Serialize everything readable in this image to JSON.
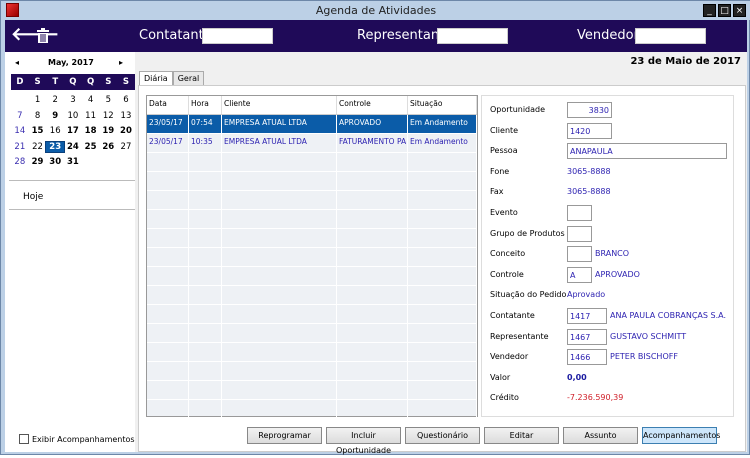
{
  "window": {
    "title": "Agenda de Atividades",
    "controls": [
      "_",
      "□",
      "×"
    ]
  },
  "header": {
    "contatante_label": "Contatante",
    "representante_label": "Representante",
    "vendedor_label": "Vendedor",
    "contatante_value": "",
    "representante_value": "",
    "vendedor_value": ""
  },
  "calendar": {
    "month": "May, 2017",
    "prev": "◂",
    "next": "▸",
    "weekdays": [
      "D",
      "S",
      "T",
      "Q",
      "Q",
      "S",
      "S"
    ],
    "weeks": [
      [
        "",
        "1",
        "2",
        "3",
        "4",
        "5",
        "6"
      ],
      [
        "7",
        "8",
        "9",
        "10",
        "11",
        "12",
        "13"
      ],
      [
        "14",
        "15",
        "16",
        "17",
        "18",
        "19",
        "20"
      ],
      [
        "21",
        "22",
        "23",
        "24",
        "25",
        "26",
        "27"
      ],
      [
        "28",
        "29",
        "30",
        "31",
        "",
        "",
        ""
      ]
    ],
    "bold_days": [
      "9",
      "15",
      "17",
      "18",
      "19",
      "20",
      "24",
      "25",
      "26",
      "29",
      "30",
      "31"
    ],
    "selected": "23"
  },
  "left": {
    "today": "Hoje",
    "show_followups": "Exibir Acompanhamentos"
  },
  "date_heading": "23 de Maio de 2017",
  "tabs": [
    "Diária",
    "Geral"
  ],
  "grid": {
    "columns": [
      "Data",
      "Hora",
      "Cliente",
      "Controle",
      "Situação"
    ],
    "rows": [
      [
        "23/05/17",
        "07:54",
        "EMPRESA ATUAL LTDA",
        "APROVADO",
        "Em Andamento"
      ],
      [
        "23/05/17",
        "10:35",
        "EMPRESA ATUAL LTDA",
        "FATURAMENTO PA",
        "Em Andamento"
      ]
    ]
  },
  "details": {
    "oportunidade": {
      "label": "Oportunidade",
      "value": "3830"
    },
    "cliente": {
      "label": "Cliente",
      "value": "1420"
    },
    "pessoa": {
      "label": "Pessoa",
      "value": "ANAPAULA"
    },
    "fone": {
      "label": "Fone",
      "value": "3065-8888"
    },
    "fax": {
      "label": "Fax",
      "value": "3065-8888"
    },
    "evento": {
      "label": "Evento",
      "value": ""
    },
    "grupo": {
      "label": "Grupo de Produtos",
      "value": ""
    },
    "conceito": {
      "label": "Conceito",
      "value": "",
      "desc": "BRANCO"
    },
    "controle": {
      "label": "Controle",
      "value": "A",
      "desc": "APROVADO"
    },
    "situacao": {
      "label": "Situação do Pedido",
      "value": "Aprovado"
    },
    "contatante": {
      "label": "Contatante",
      "value": "1417",
      "desc": "ANA PAULA COBRANÇAS S.A."
    },
    "representante": {
      "label": "Representante",
      "value": "1467",
      "desc": "GUSTAVO SCHMITT"
    },
    "vendedor": {
      "label": "Vendedor",
      "value": "1466",
      "desc": "PETER BISCHOFF"
    },
    "valor": {
      "label": "Valor",
      "value": "0,00"
    },
    "credito": {
      "label": "Crédito",
      "value": "-7.236.590,39"
    }
  },
  "buttons": [
    "Reprogramar",
    "Incluir Oportunidade",
    "Questionário",
    "Editar",
    "Assunto",
    "Acompanhamentos"
  ],
  "colors": {
    "header": "#1f0a58",
    "selection": "#0b5ca8",
    "value_text": "#2a1fb0",
    "negative": "#d0202a"
  }
}
